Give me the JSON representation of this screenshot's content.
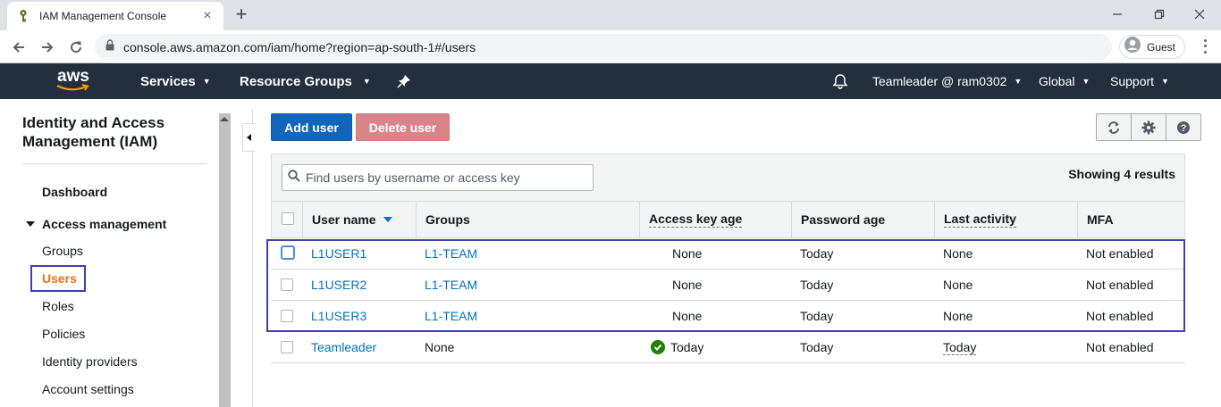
{
  "browser": {
    "tab_title": "IAM Management Console",
    "url": "console.aws.amazon.com/iam/home?region=ap-south-1#/users",
    "profile_label": "Guest"
  },
  "awsnav": {
    "logo_text": "aws",
    "services": "Services",
    "resource_groups": "Resource Groups",
    "account": "Teamleader @ ram0302",
    "region": "Global",
    "support": "Support"
  },
  "sidebar": {
    "title": "Identity and Access Management (IAM)",
    "dashboard": "Dashboard",
    "group_access": "Access management",
    "items": [
      "Groups",
      "Users",
      "Roles",
      "Policies",
      "Identity providers",
      "Account settings"
    ],
    "active": "Users"
  },
  "toolbar": {
    "add_user": "Add user",
    "delete_user": "Delete user"
  },
  "filter": {
    "placeholder": "Find users by username or access key",
    "results": "Showing 4 results"
  },
  "table": {
    "columns": [
      "User name",
      "Groups",
      "Access key age",
      "Password age",
      "Last activity",
      "MFA"
    ],
    "rows": [
      {
        "user": "L1USER1",
        "groups": "L1-TEAM",
        "access_key_age": "None",
        "password_age": "Today",
        "last_activity": "None",
        "mfa": "Not enabled"
      },
      {
        "user": "L1USER2",
        "groups": "L1-TEAM",
        "access_key_age": "None",
        "password_age": "Today",
        "last_activity": "None",
        "mfa": "Not enabled"
      },
      {
        "user": "L1USER3",
        "groups": "L1-TEAM",
        "access_key_age": "None",
        "password_age": "Today",
        "last_activity": "None",
        "mfa": "Not enabled"
      },
      {
        "user": "Teamleader",
        "groups": "None",
        "access_key_age": "Today",
        "password_age": "Today",
        "last_activity": "Today",
        "mfa": "Not enabled"
      }
    ]
  },
  "colors": {
    "aws_nav": "#232f3e",
    "primary_button": "#1166bb",
    "danger_button": "#d8858a",
    "active_nav": "#ec7211",
    "link": "#0073bb",
    "highlight_box": "#3f3fb0"
  }
}
